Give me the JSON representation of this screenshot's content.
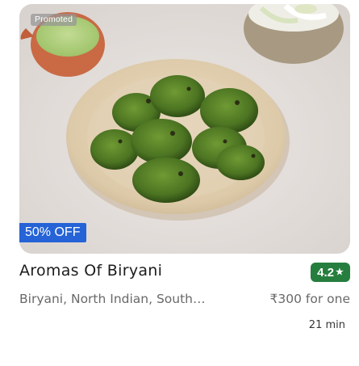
{
  "card": {
    "promoted_label": "Promoted",
    "offer_label": "50% OFF",
    "restaurant_name": "Aromas Of Biryani",
    "rating": "4.2",
    "rating_icon": "star-icon",
    "cuisines": "Biryani, North Indian, South Indian",
    "price_for_one": "₹300 for one",
    "delivery_time": "21 min"
  },
  "colors": {
    "offer_badge": "#2563d6",
    "rating_badge": "#267e3e",
    "text_primary": "#1c1c1c",
    "text_secondary": "#696969"
  }
}
